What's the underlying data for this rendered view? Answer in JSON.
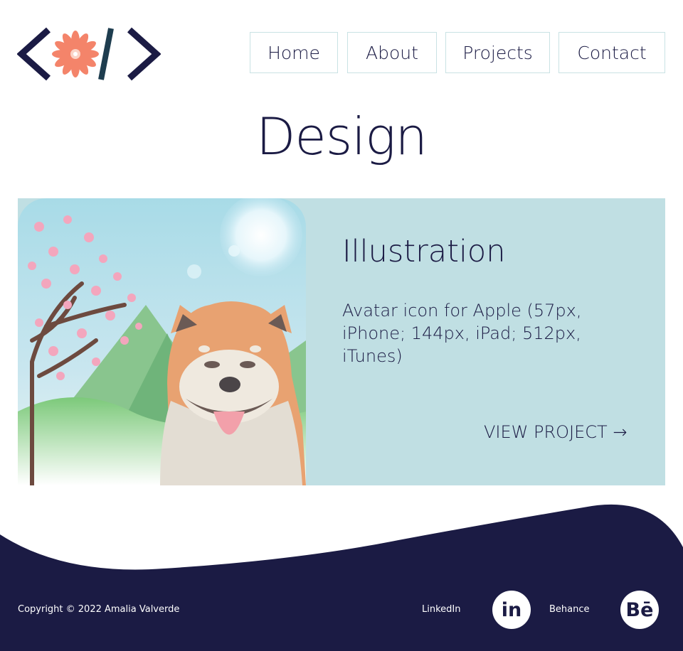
{
  "nav": {
    "items": [
      {
        "label": "Home"
      },
      {
        "label": "About"
      },
      {
        "label": "Projects"
      },
      {
        "label": "Contact"
      }
    ]
  },
  "page": {
    "title": "Design"
  },
  "project": {
    "title": "Illustration",
    "description": "Avatar icon for Apple (57px, iPhone; 144px, iPad; 512px, iTunes)",
    "link_label": "VIEW PROJECT →"
  },
  "footer": {
    "copyright": "Copyright © 2022 Amalia Valverde",
    "social": [
      {
        "label": "LinkedIn",
        "icon_text": "in",
        "icon": "linkedin-icon"
      },
      {
        "label": "Behance",
        "icon_text": "Bē",
        "icon": "behance-icon"
      }
    ]
  },
  "colors": {
    "navy": "#1b1b44",
    "card_bg": "#c0dfe3",
    "nav_border": "#c9e2e4",
    "flower": "#f4846a"
  },
  "icons": {
    "logo": "code-brackets-flower-logo",
    "project_image": "shiba-dog-cherry-blossom-illustration"
  }
}
